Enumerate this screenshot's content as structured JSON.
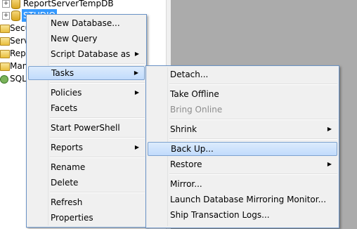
{
  "tree": {
    "nodes": [
      "ReportServerTempDB",
      "STUDIO",
      "Secu",
      "Serve",
      "Repl",
      "Man",
      "SQL"
    ],
    "expander_symbol": "+"
  },
  "context_menu": {
    "items": [
      "New Database...",
      "New Query",
      "Script Database as",
      "Tasks",
      "Policies",
      "Facets",
      "Start PowerShell",
      "Reports",
      "Rename",
      "Delete",
      "Refresh",
      "Properties"
    ]
  },
  "tasks_submenu": {
    "items": [
      "Detach...",
      "Take Offline",
      "Bring Online",
      "Shrink",
      "Back Up...",
      "Restore",
      "Mirror...",
      "Launch Database Mirroring Monitor...",
      "Ship Transaction Logs..."
    ]
  },
  "icons": {
    "submenu_arrow": "submenu-arrow-icon"
  },
  "colors": {
    "highlight": "#c1dbfc",
    "selection": "#3399ff",
    "menu_border": "#6a93c6",
    "disabled_text": "#8d8d8d",
    "right_panel": "#ababab"
  }
}
